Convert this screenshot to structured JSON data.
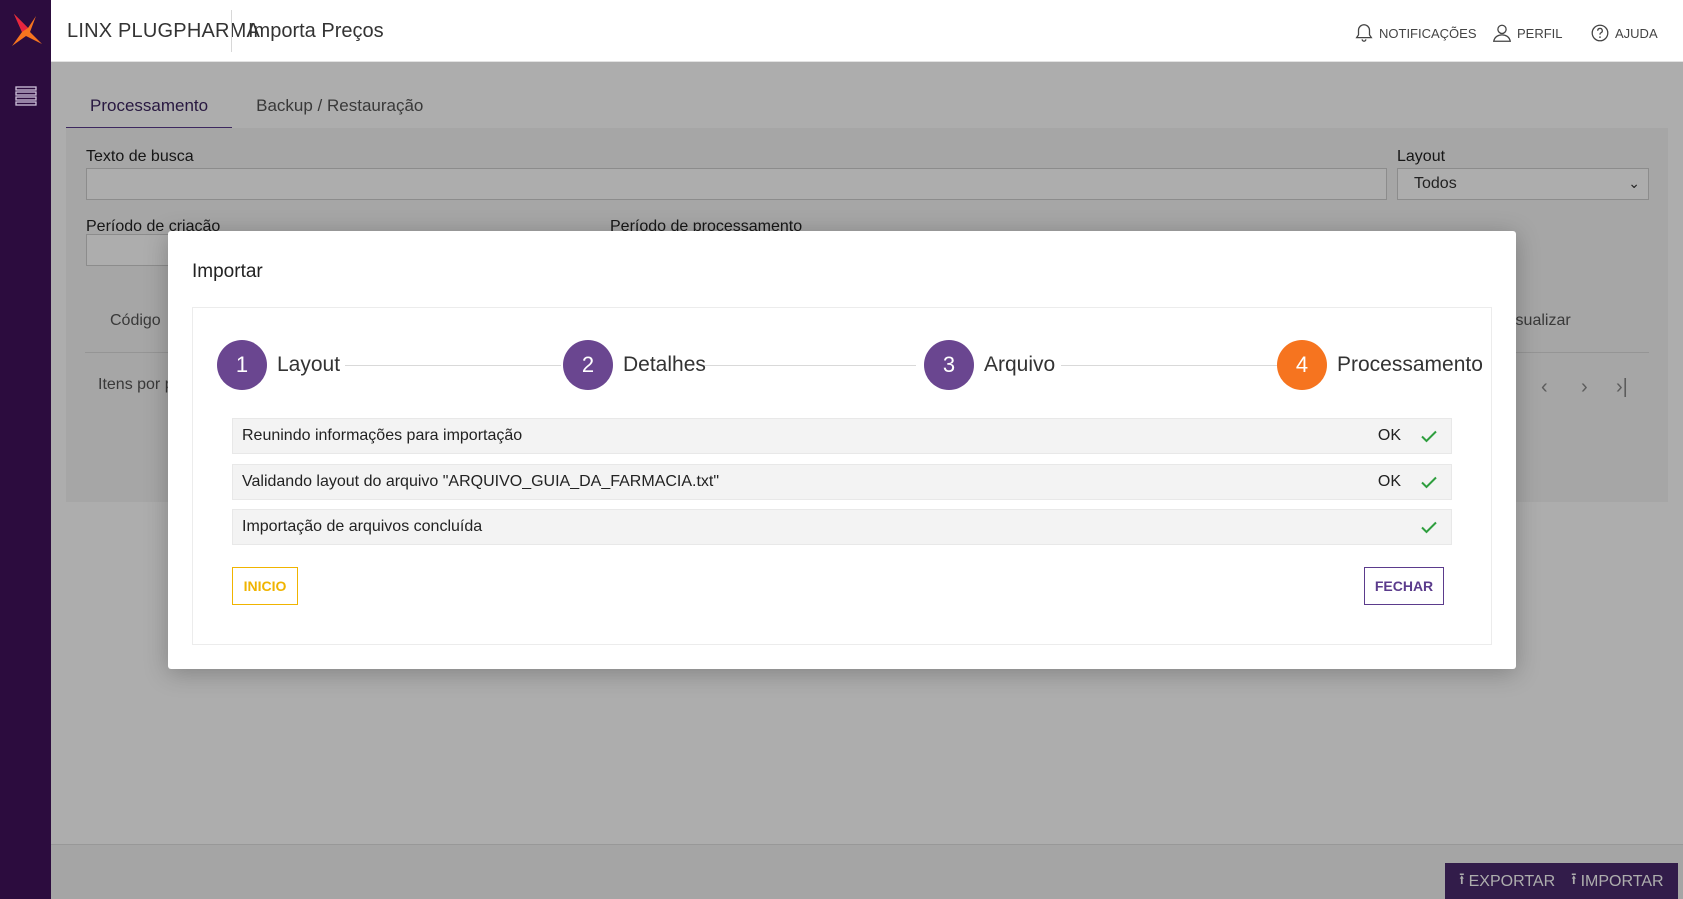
{
  "app": {
    "brand": "LINX PLUGPHARMA",
    "page_title": "Importa Preços"
  },
  "header": {
    "notifications_label": "NOTIFICAÇÕES",
    "profile_label": "PERFIL",
    "help_label": "AJUDA"
  },
  "tabs": [
    {
      "label": "Processamento",
      "active": true
    },
    {
      "label": "Backup / Restauração",
      "active": false
    }
  ],
  "filters": {
    "search_label": "Texto de busca",
    "layout_label": "Layout",
    "layout_value": "Todos",
    "created_period_label": "Período de criação",
    "processed_period_label": "Período de processamento"
  },
  "table": {
    "col_code": "Código",
    "col_view": "isualizar",
    "items_per_page": "Itens por p"
  },
  "footer": {
    "export_label": "EXPORTAR",
    "import_label": "IMPORTAR"
  },
  "modal": {
    "title": "Importar",
    "steps": [
      {
        "number": "1",
        "label": "Layout"
      },
      {
        "number": "2",
        "label": "Detalhes"
      },
      {
        "number": "3",
        "label": "Arquivo"
      },
      {
        "number": "4",
        "label": "Processamento"
      }
    ],
    "status_rows": [
      {
        "text": "Reunindo informações para importação",
        "status": "OK"
      },
      {
        "text": "Validando layout do arquivo \"ARQUIVO_GUIA_DA_FARMACIA.txt\"",
        "status": "OK"
      },
      {
        "text": "Importação de arquivos concluída",
        "status": ""
      }
    ],
    "inicio_label": "INICIO",
    "fechar_label": "FECHAR"
  },
  "colors": {
    "sidebar": "#2c0c3e",
    "primary": "#5b3b8c",
    "step_done": "#6a4690",
    "step_current": "#f6741f",
    "check": "#2e9e3e",
    "warning_button": "#f0b400"
  }
}
